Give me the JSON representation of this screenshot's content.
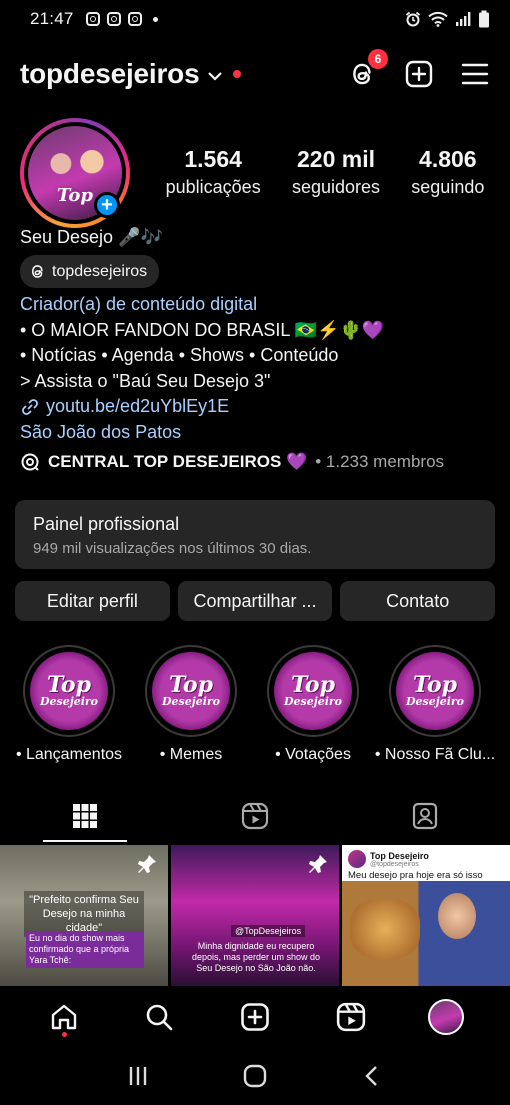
{
  "status_bar": {
    "time": "21:47",
    "notification_icons": [
      "instagram-icon",
      "instagram-icon",
      "instagram-icon"
    ],
    "system_icons": [
      "alarm-icon",
      "wifi-icon",
      "signal-icon",
      "battery-icon"
    ]
  },
  "header": {
    "username": "topdesejeiros",
    "threads_badge_count": "6",
    "accent_color": "#ff3040"
  },
  "profile": {
    "avatar_text": "Top",
    "stats": [
      {
        "value": "1.564",
        "label": "publicações"
      },
      {
        "value": "220 mil",
        "label": "seguidores"
      },
      {
        "value": "4.806",
        "label": "seguindo"
      }
    ],
    "display_name": "Seu Desejo 🎤🎶",
    "threads_handle": "topdesejeiros",
    "category": "Criador(a) de conteúdo digital",
    "bio_lines": [
      "• O MAIOR FANDON DO BRASIL 🇧🇷⚡🌵💜",
      "• Notícias • Agenda • Shows • Conteúdo",
      "> Assista o \"Baú Seu Desejo 3\""
    ],
    "link": "youtu.be/ed2uYblEy1E",
    "location": "São João dos Patos"
  },
  "channel": {
    "name": "CENTRAL TOP DESEJEIROS 💜",
    "members": "• 1.233 membros"
  },
  "panel": {
    "title": "Painel profissional",
    "subtitle": "949 mil visualizações nos últimos 30 dias."
  },
  "buttons": {
    "edit": "Editar perfil",
    "share": "Compartilhar ...",
    "contact": "Contato"
  },
  "highlights": [
    {
      "label": "• Lançamentos"
    },
    {
      "label": "• Memes"
    },
    {
      "label": "• Votações"
    },
    {
      "label": "• Nosso Fã Clu..."
    }
  ],
  "highlight_badge": {
    "top": "Top",
    "sub": "Desejeiro"
  },
  "tabs": [
    "grid-icon",
    "reels-icon",
    "tagged-icon"
  ],
  "posts": [
    {
      "caption": "\"Prefeito confirma Seu Desejo na minha cidade\"",
      "subcaption": "Eu no dia do show mais confirmado que a própria Yara Tchê:",
      "pinned": true
    },
    {
      "tag": "@TopDesejeiros",
      "caption": "Minha dignidade eu recupero depois, mas perder um show do Seu Desejo no São João não.",
      "pinned": true
    },
    {
      "author": "Top Desejeiro",
      "handle": "@topdesejeiros",
      "text": "Meu desejo  pra hoje era só isso aqui:",
      "pinned": false
    }
  ],
  "bottom_nav": [
    "home-icon",
    "search-icon",
    "create-icon",
    "reels-icon",
    "profile-avatar"
  ]
}
